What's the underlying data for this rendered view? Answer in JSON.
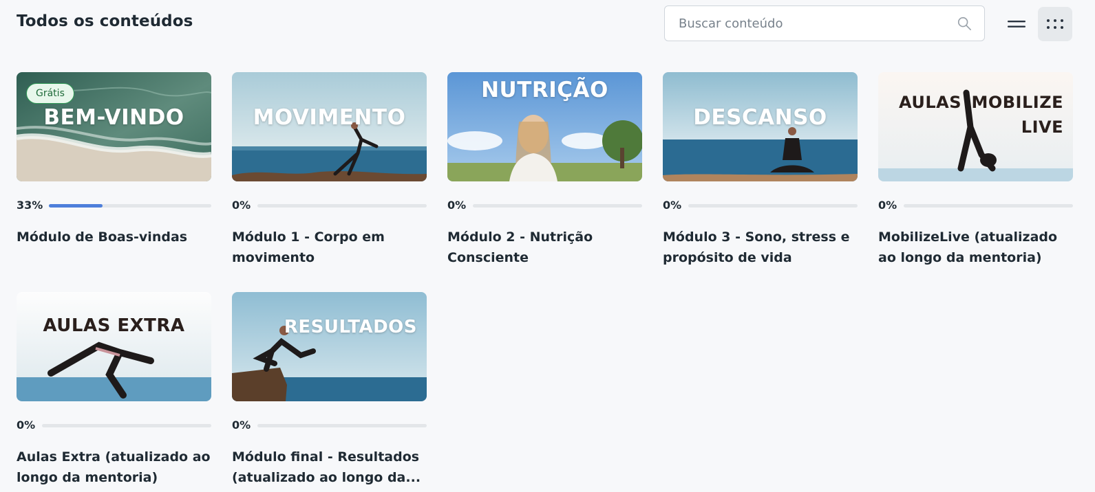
{
  "header": {
    "title": "Todos os conteúdos",
    "search_placeholder": "Buscar conteúdo",
    "icons": {
      "search": "search-icon",
      "list_view": "list-view-icon",
      "grid_view": "grid-view-icon"
    }
  },
  "colors": {
    "accent": "#4e7fdb",
    "badge_bg": "#e8f7ec",
    "badge_border": "#2f9a55",
    "background": "#f7f8fa"
  },
  "modules": [
    {
      "thumb_title": "BEM-VINDO",
      "badge": "Grátis",
      "progress": 33,
      "progress_label": "33%",
      "title": "Módulo de Boas-vindas"
    },
    {
      "thumb_title": "MOVIMENTO",
      "progress": 0,
      "progress_label": "0%",
      "title": "Módulo 1 - Corpo em movimento"
    },
    {
      "thumb_title": "NUTRIÇÃO",
      "progress": 0,
      "progress_label": "0%",
      "title": "Módulo 2 - Nutrição Consciente"
    },
    {
      "thumb_title": "DESCANSO",
      "progress": 0,
      "progress_label": "0%",
      "title": "Módulo 3 - Sono, stress e propósito de vida"
    },
    {
      "thumb_title_left": "AULAS",
      "thumb_title_right": "MOBILIZE",
      "thumb_title_right2": "LIVE",
      "progress": 0,
      "progress_label": "0%",
      "title": "MobilizeLive (atualizado ao longo da mentoria)"
    },
    {
      "thumb_title": "AULAS EXTRA",
      "progress": 0,
      "progress_label": "0%",
      "title": "Aulas Extra (atualizado ao longo da mentoria)"
    },
    {
      "thumb_title": "RESULTADOS",
      "progress": 0,
      "progress_label": "0%",
      "title": "Módulo final - Resultados (atualizado ao longo da..."
    }
  ]
}
